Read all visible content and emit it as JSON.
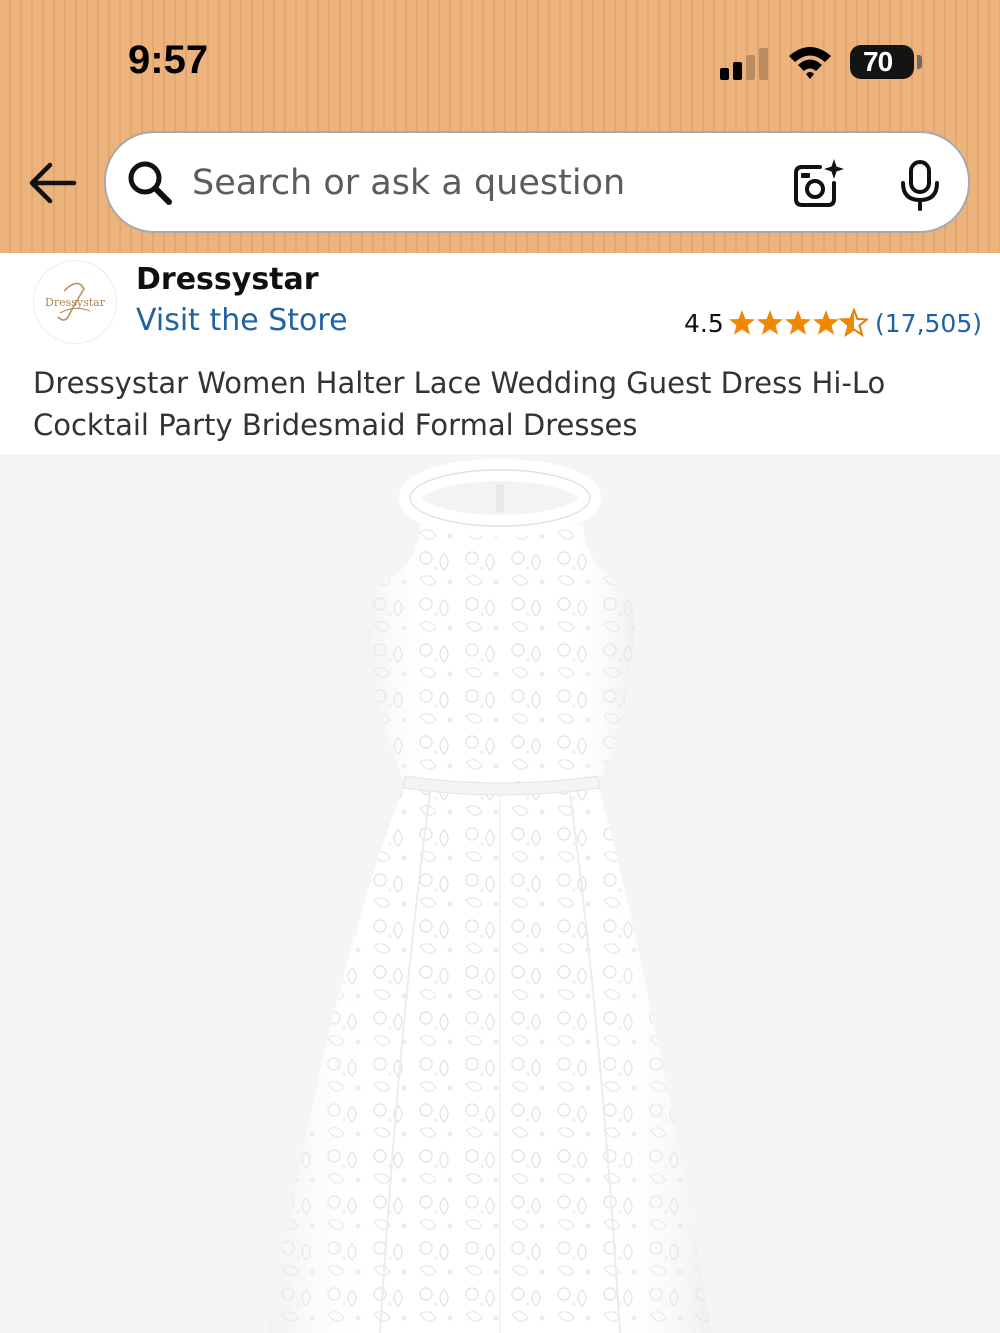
{
  "status_bar": {
    "time": "9:57",
    "battery": "70"
  },
  "search": {
    "placeholder": "Search or ask a question",
    "value": ""
  },
  "store": {
    "logo_text": "Dressystar",
    "name": "Dressystar",
    "visit_label": "Visit the Store"
  },
  "rating": {
    "value": "4.5",
    "stars": 4.5,
    "count": "(17,505)"
  },
  "product": {
    "title": "Dressystar Women Halter Lace Wedding Guest Dress Hi-Lo Cocktail Party Bridesmaid Formal Dresses"
  },
  "colors": {
    "header": "#ecb47c",
    "link": "#2162a1",
    "star": "#f08804",
    "image_bg": "#f5f5f5"
  },
  "icons": [
    "back-arrow-icon",
    "search-icon",
    "camera-icon",
    "microphone-icon",
    "signal-icon",
    "wifi-icon",
    "battery-icon"
  ]
}
